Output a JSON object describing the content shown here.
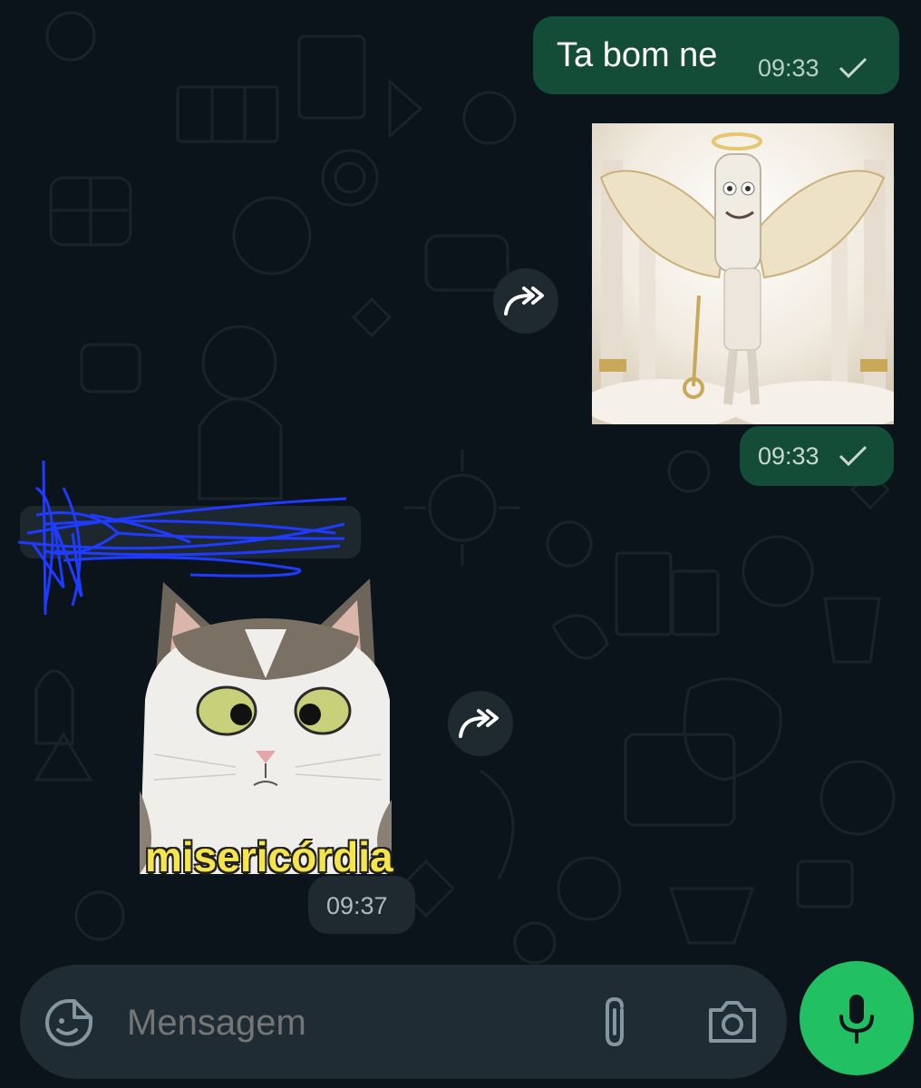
{
  "messages": [
    {
      "text": "Ta bom ne",
      "time": "09:33",
      "direction": "outgoing",
      "status": "sent"
    },
    {
      "image": "angel-character-with-wings",
      "time": "09:33",
      "direction": "outgoing",
      "status": "sent"
    },
    {
      "sticker": "surprised-cat",
      "caption": "misericórdia",
      "time": "09:37",
      "direction": "incoming"
    }
  ],
  "composer": {
    "placeholder": "Mensagem"
  },
  "icons": {
    "emoji": "sticker-smile-icon",
    "attach": "paperclip-icon",
    "camera": "camera-icon",
    "mic": "microphone-icon",
    "forward": "forward-icon",
    "tick": "single-check-icon"
  },
  "colors": {
    "background": "#0b141a",
    "outgoing_bubble": "#144d37",
    "incoming_pill": "#1f2a30",
    "composer": "#1f2c34",
    "mic_button": "#21c063",
    "caption": "#f6e54a"
  }
}
